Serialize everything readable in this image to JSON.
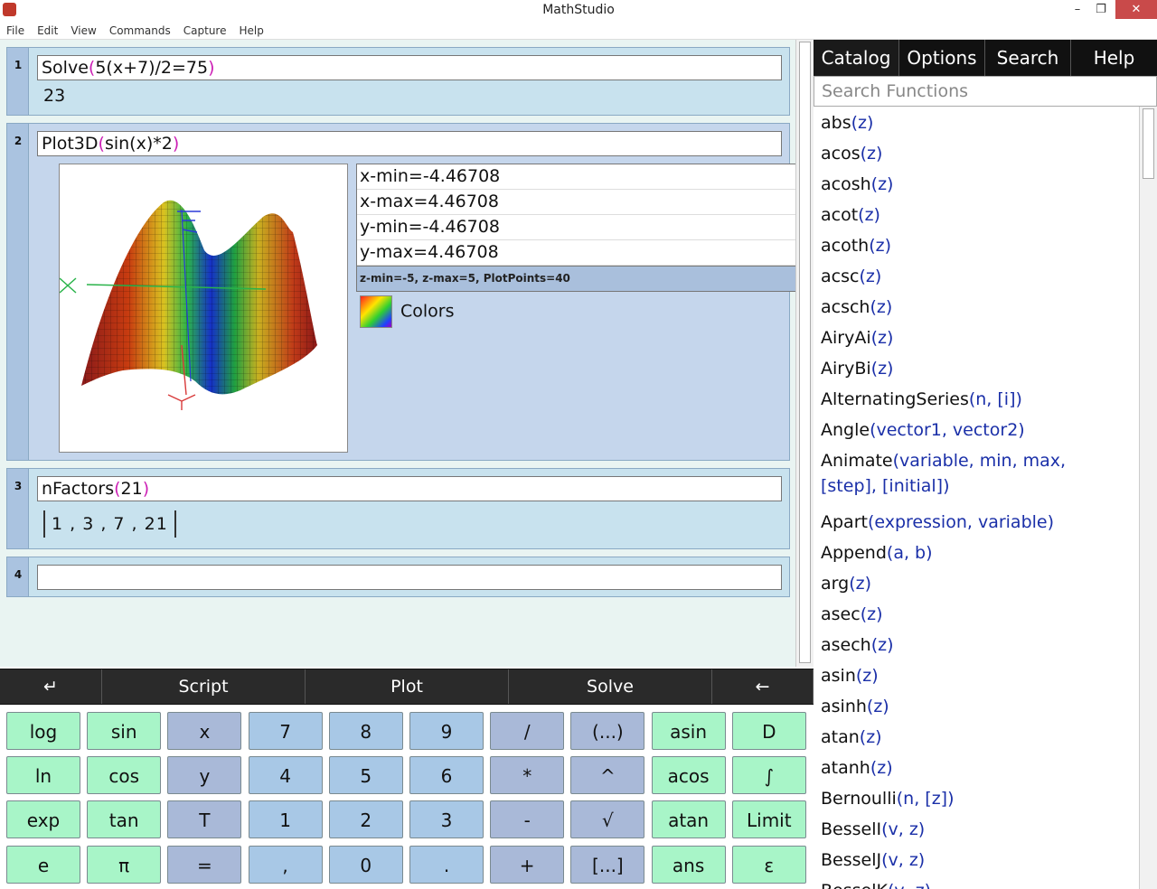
{
  "window": {
    "title": "MathStudio",
    "minimize": "–",
    "maximize": "❐",
    "close": "✕"
  },
  "menu": [
    "File",
    "Edit",
    "View",
    "Commands",
    "Capture",
    "Help"
  ],
  "cells": [
    {
      "number": "1",
      "input_fn": "Solve",
      "input_args": "5(x+7)/2=75",
      "output": "23"
    },
    {
      "number": "2",
      "input_fn": "Plot3D",
      "input_args": "sin(x)*2",
      "bounds": [
        "x-min=-4.46708",
        "x-max=4.46708",
        "y-min=-4.46708",
        "y-max=4.46708"
      ],
      "note": "z-min=-5, z-max=5, PlotPoints=40",
      "colors_label": "Colors"
    },
    {
      "number": "3",
      "input_fn": "nFactors",
      "input_args": "21",
      "output": "1 ,  3 ,  7 ,  21"
    },
    {
      "number": "4",
      "input_value": ""
    }
  ],
  "toolbar": {
    "enter": "↵",
    "script": "Script",
    "plot": "Plot",
    "solve": "Solve",
    "backspace": "←"
  },
  "keypad": [
    [
      "log",
      "sin",
      "x",
      "7",
      "8",
      "9",
      "/",
      "(...)",
      "asin",
      "D"
    ],
    [
      "ln",
      "cos",
      "y",
      "4",
      "5",
      "6",
      "*",
      "^",
      "acos",
      "∫"
    ],
    [
      "exp",
      "tan",
      "T",
      "1",
      "2",
      "3",
      "-",
      "√",
      "atan",
      "Limit"
    ],
    [
      "e",
      "π",
      "=",
      ",",
      "0",
      ".",
      "+",
      "[...]",
      "ans",
      "ε"
    ]
  ],
  "panel": {
    "tabs": [
      "Catalog",
      "Options",
      "Search",
      "Help"
    ],
    "search_placeholder": "Search Functions",
    "functions": [
      {
        "name": "abs",
        "args": "(z)"
      },
      {
        "name": "acos",
        "args": "(z)"
      },
      {
        "name": "acosh",
        "args": "(z)"
      },
      {
        "name": "acot",
        "args": "(z)"
      },
      {
        "name": "acoth",
        "args": "(z)"
      },
      {
        "name": "acsc",
        "args": "(z)"
      },
      {
        "name": "acsch",
        "args": "(z)"
      },
      {
        "name": "AiryAi",
        "args": "(z)"
      },
      {
        "name": "AiryBi",
        "args": "(z)"
      },
      {
        "name": "AlternatingSeries",
        "args": "(n, [i])"
      },
      {
        "name": "Angle",
        "args": "(vector1, vector2)"
      },
      {
        "name": "Animate",
        "args": "(variable, min, max,",
        "args2": "[step], [initial])"
      },
      {
        "name": "Apart",
        "args": "(expression, variable)"
      },
      {
        "name": "Append",
        "args": "(a, b)"
      },
      {
        "name": "arg",
        "args": "(z)"
      },
      {
        "name": "asec",
        "args": "(z)"
      },
      {
        "name": "asech",
        "args": "(z)"
      },
      {
        "name": "asin",
        "args": "(z)"
      },
      {
        "name": "asinh",
        "args": "(z)"
      },
      {
        "name": "atan",
        "args": "(z)"
      },
      {
        "name": "atanh",
        "args": "(z)"
      },
      {
        "name": "Bernoulli",
        "args": "(n, [z])"
      },
      {
        "name": "BesselI",
        "args": "(v, z)"
      },
      {
        "name": "BesselJ",
        "args": "(v, z)"
      },
      {
        "name": "BesselK",
        "args": "(v, z)"
      }
    ]
  }
}
